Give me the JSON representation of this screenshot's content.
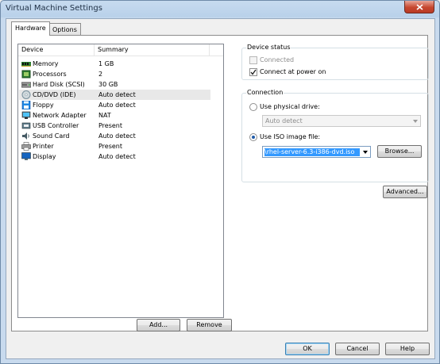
{
  "window": {
    "title": "Virtual Machine Settings"
  },
  "tabs": [
    {
      "label": "Hardware"
    },
    {
      "label": "Options"
    }
  ],
  "device_list": {
    "columns": [
      "Device",
      "Summary"
    ],
    "rows": [
      {
        "device": "Memory",
        "summary": "1 GB",
        "icon": "memory-icon"
      },
      {
        "device": "Processors",
        "summary": "2",
        "icon": "processor-icon"
      },
      {
        "device": "Hard Disk (SCSI)",
        "summary": "30 GB",
        "icon": "hard-disk-icon"
      },
      {
        "device": "CD/DVD (IDE)",
        "summary": "Auto detect",
        "icon": "cd-dvd-icon",
        "selected": true
      },
      {
        "device": "Floppy",
        "summary": "Auto detect",
        "icon": "floppy-icon"
      },
      {
        "device": "Network Adapter",
        "summary": "NAT",
        "icon": "network-adapter-icon"
      },
      {
        "device": "USB Controller",
        "summary": "Present",
        "icon": "usb-controller-icon"
      },
      {
        "device": "Sound Card",
        "summary": "Auto detect",
        "icon": "sound-card-icon"
      },
      {
        "device": "Printer",
        "summary": "Present",
        "icon": "printer-icon"
      },
      {
        "device": "Display",
        "summary": "Auto detect",
        "icon": "display-icon"
      }
    ]
  },
  "list_buttons": {
    "add": "Add...",
    "remove": "Remove"
  },
  "device_status": {
    "label": "Device status",
    "connected": {
      "label": "Connected",
      "checked": false,
      "enabled": false
    },
    "connect_at_power_on": {
      "label": "Connect at power on",
      "checked": true
    }
  },
  "connection": {
    "label": "Connection",
    "use_physical_drive": {
      "label": "Use physical drive:",
      "selected": false
    },
    "physical_drive_value": "Auto detect",
    "use_iso_image": {
      "label": "Use ISO image file:",
      "selected": true
    },
    "iso_path": "\\rhel-server-6.3-i386-dvd.iso",
    "browse": "Browse..."
  },
  "advanced_button": "Advanced...",
  "dialog_buttons": {
    "ok": "OK",
    "cancel": "Cancel",
    "help": "Help"
  },
  "colors": {
    "selection": "#3399ff",
    "title_bar": "#b9d1ea",
    "close_button": "#c7472f"
  }
}
